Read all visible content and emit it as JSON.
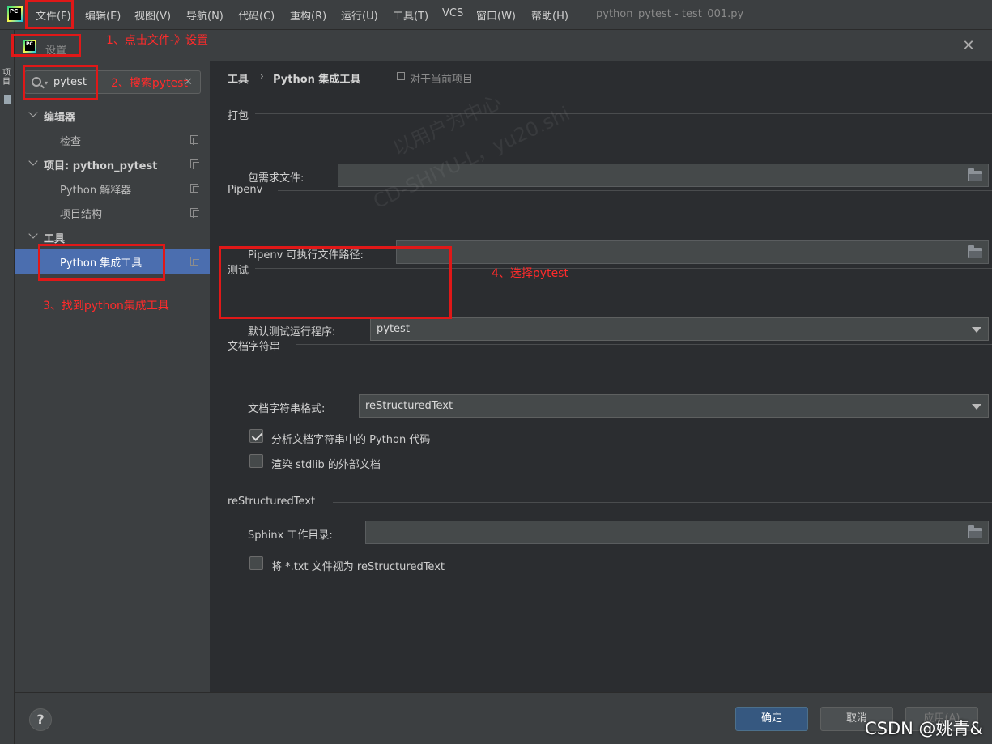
{
  "menubar": {
    "app_icon_text": "PC",
    "items": [
      "文件(F)",
      "编辑(E)",
      "视图(V)",
      "导航(N)",
      "代码(C)",
      "重构(R)",
      "运行(U)",
      "工具(T)",
      "VCS",
      "窗口(W)",
      "帮助(H)"
    ],
    "window_title": "python_pytest - test_001.py"
  },
  "toolstrip": {
    "project_label": "项目"
  },
  "dialog": {
    "icon_text": "PC",
    "title": "设置",
    "close_symbol": "✕"
  },
  "sidebar": {
    "search_value": "pytest",
    "search_clear": "✕",
    "tree": [
      {
        "label": "编辑器",
        "level": 0,
        "expanded": true
      },
      {
        "label": "检查",
        "level": 1
      },
      {
        "label": "项目: python_pytest",
        "level": 0,
        "expanded": true
      },
      {
        "label": "Python 解释器",
        "level": 1
      },
      {
        "label": "项目结构",
        "level": 1
      },
      {
        "label": "工具",
        "level": 0,
        "expanded": true
      },
      {
        "label": "Python 集成工具",
        "level": 1,
        "selected": true
      }
    ]
  },
  "content": {
    "breadcrumb_parent": "工具",
    "breadcrumb_sep": "›",
    "breadcrumb_current": "Python 集成工具",
    "scope_label": "对于当前项目",
    "packaging": {
      "section": "打包",
      "requirements_label": "包需求文件:",
      "requirements_value": ""
    },
    "pipenv": {
      "section": "Pipenv",
      "path_label": "Pipenv 可执行文件路径:",
      "path_value": ""
    },
    "testing": {
      "section": "测试",
      "runner_label": "默认测试运行程序:",
      "runner_value": "pytest"
    },
    "docstrings": {
      "section": "文档字符串",
      "format_label": "文档字符串格式:",
      "format_value": "reStructuredText",
      "analyze_label": "分析文档字符串中的 Python 代码",
      "analyze_checked": true,
      "render_label": "渲染 stdlib 的外部文档",
      "render_checked": false
    },
    "rst": {
      "section": "reStructuredText",
      "sphinx_label": "Sphinx 工作目录:",
      "sphinx_value": "",
      "txt_label": "将 *.txt 文件视为 reStructuredText",
      "txt_checked": false
    }
  },
  "footer": {
    "help": "?",
    "ok": "确定",
    "cancel": "取消",
    "apply": "应用(A)"
  },
  "annotations": {
    "step1": "1、点击文件-》设置",
    "step2": "2、搜索pytest",
    "step3": "3、找到python集成工具",
    "step4": "4、选择pytest"
  },
  "watermark": {
    "line1": "以用户为中心",
    "line2": "CD-SHIYU-L，yu20.shi"
  },
  "csdn_tag": "CSDN @姚青&",
  "colors": {
    "annotation": "#e01818",
    "selection": "#4b6eaf",
    "primary_button": "#365880"
  }
}
